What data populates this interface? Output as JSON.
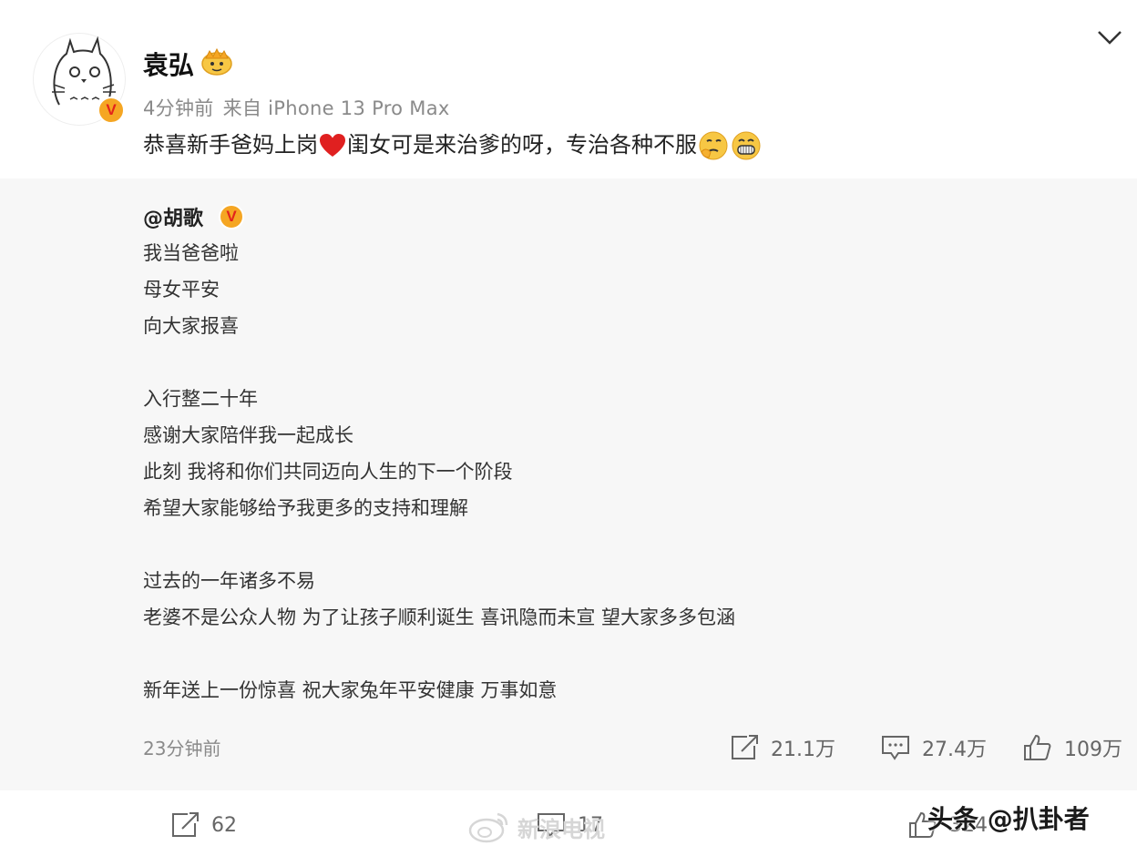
{
  "post": {
    "username": "袁弘",
    "time": "4分钟前",
    "source": "来自 iPhone 13 Pro Max",
    "text_before_heart": "恭喜新手爸妈上岗",
    "text_after_heart": "闺女可是来治爹的呀，专治各种不服",
    "heart_color": "#e02020"
  },
  "repost": {
    "username": "@胡歌",
    "lines": [
      "我当爸爸啦",
      "母女平安",
      "向大家报喜",
      "",
      "入行整二十年",
      "感谢大家陪伴我一起成长",
      "此刻 我将和你们共同迈向人生的下一个阶段",
      "希望大家能够给予我更多的支持和理解",
      "",
      "过去的一年诸多不易",
      "老婆不是公众人物 为了让孩子顺利诞生 喜讯隐而未宣 望大家多多包涵",
      "",
      "新年送上一份惊喜 祝大家兔年平安健康 万事如意"
    ],
    "time": "23分钟前",
    "reposts": "21.1万",
    "comments": "27.4万",
    "likes": "109万"
  },
  "badge": {
    "verified_letter": "V",
    "color": "#f5a623"
  },
  "bottom": {
    "reposts": "62",
    "comments": "17",
    "likes": "324",
    "watermark": "新浪电视",
    "toutiao_watermark": "头条 @扒卦者"
  },
  "icons": [
    "chevron-down-icon",
    "share-icon",
    "comment-icon",
    "like-icon",
    "weibo-logo-icon"
  ]
}
